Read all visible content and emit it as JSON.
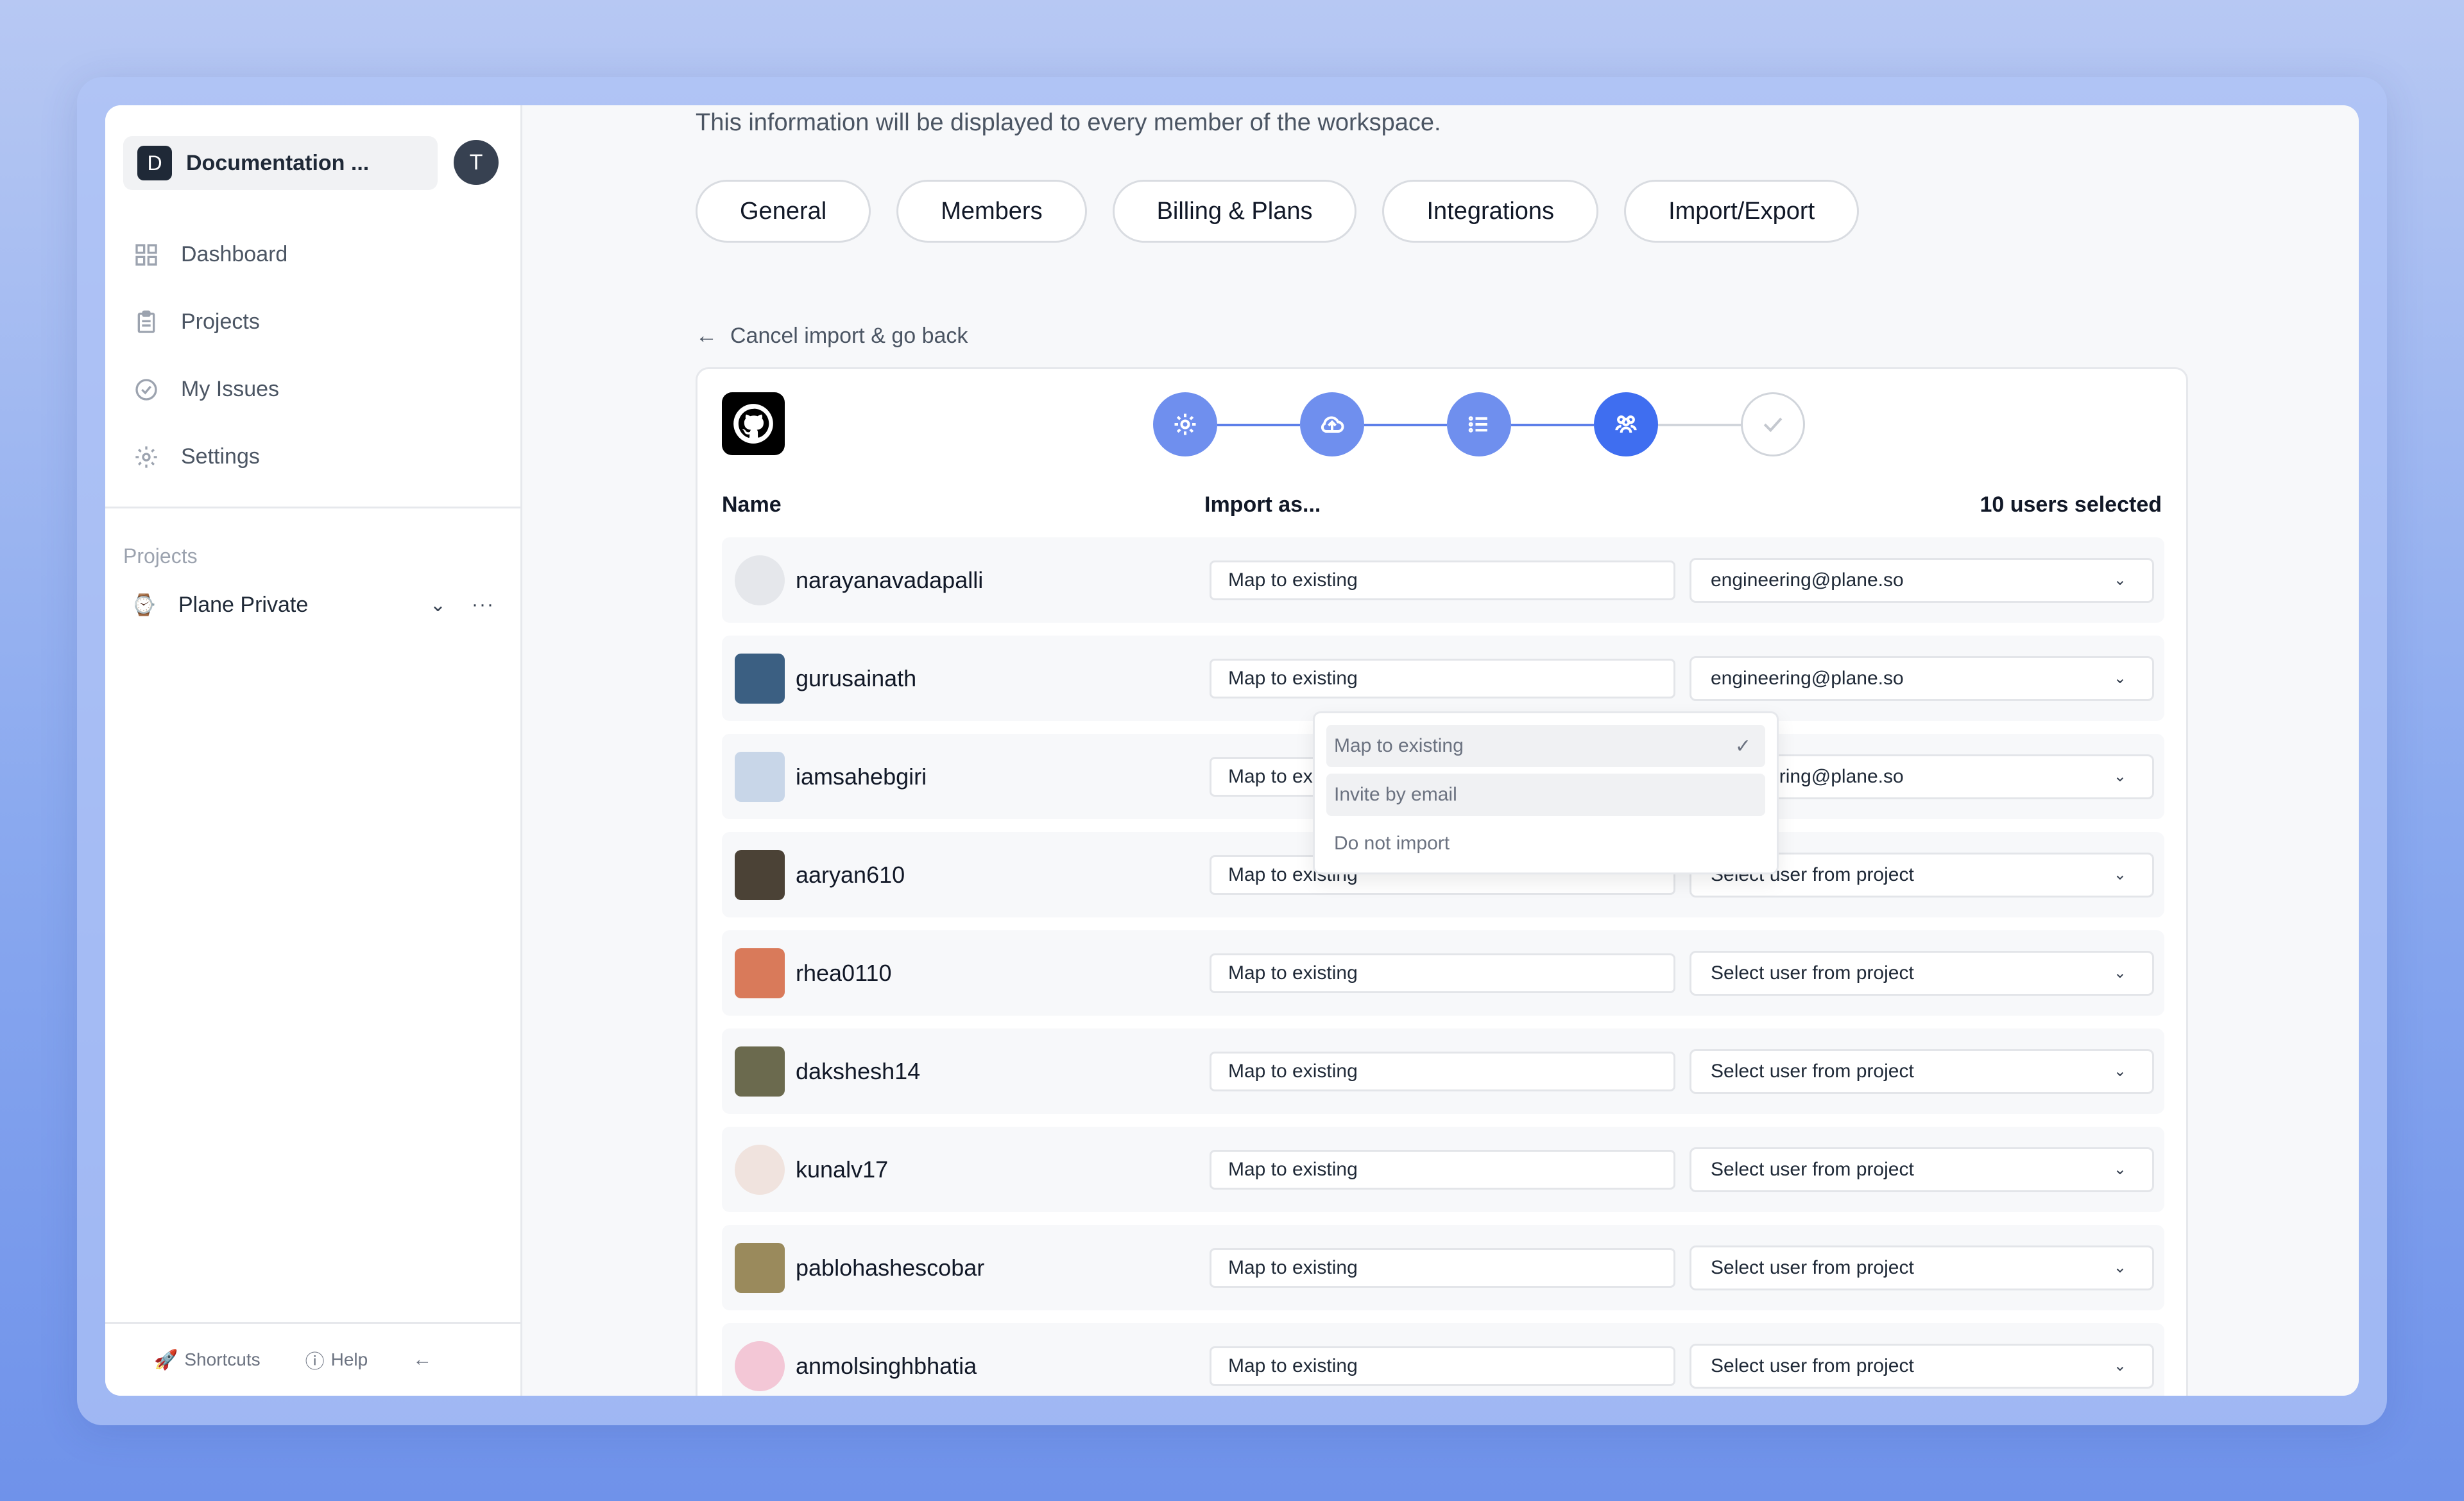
{
  "sidebar": {
    "workspace_badge": "D",
    "workspace_name": "Documentation ...",
    "user_avatar": "T",
    "nav": [
      {
        "label": "Dashboard",
        "icon": "grid-icon"
      },
      {
        "label": "Projects",
        "icon": "clipboard-icon"
      },
      {
        "label": "My Issues",
        "icon": "check-circle-icon"
      },
      {
        "label": "Settings",
        "icon": "gear-icon"
      }
    ],
    "projects_heading": "Projects",
    "project": {
      "name": "Plane Private",
      "icon": "watch-icon"
    },
    "footer": {
      "shortcuts": "Shortcuts",
      "help": "Help"
    }
  },
  "main": {
    "info_text": "This information will be displayed to every member of the workspace.",
    "tabs": [
      "General",
      "Members",
      "Billing & Plans",
      "Integrations",
      "Import/Export"
    ],
    "back_link": "Cancel import & go back",
    "columns": {
      "name": "Name",
      "import_as": "Import as...",
      "selected": "10 users selected"
    },
    "rows": [
      {
        "name": "narayanavadapalli",
        "import_as": "Map to existing",
        "target": "engineering@plane.so",
        "avatar_color": "#e5e7eb"
      },
      {
        "name": "gurusainath",
        "import_as": "Map to existing",
        "target": "engineering@plane.so",
        "avatar_color": "#3b5f82"
      },
      {
        "name": "iamsahebgiri",
        "import_as": "Map to existing",
        "target": "engineering@plane.so",
        "avatar_color": "#c8d6e8"
      },
      {
        "name": "aaryan610",
        "import_as": "Map to existing",
        "target": "Select user from project",
        "avatar_color": "#4b4236"
      },
      {
        "name": "rhea0110",
        "import_as": "Map to existing",
        "target": "Select user from project",
        "avatar_color": "#d97a5a"
      },
      {
        "name": "dakshesh14",
        "import_as": "Map to existing",
        "target": "Select user from project",
        "avatar_color": "#6b6a4e"
      },
      {
        "name": "kunalv17",
        "import_as": "Map to existing",
        "target": "Select user from project",
        "avatar_color": "#f0e3de"
      },
      {
        "name": "pablohashescobar",
        "import_as": "Map to existing",
        "target": "Select user from project",
        "avatar_color": "#9a8a5c"
      },
      {
        "name": "anmolsinghbhatia",
        "import_as": "Map to existing",
        "target": "Select user from project",
        "avatar_color": "#f3c7d6"
      }
    ],
    "dropdown": {
      "options": [
        "Map to existing",
        "Invite by email",
        "Do not import"
      ],
      "selected": "Map to existing"
    }
  },
  "colors": {
    "accent": "#3f6ef0",
    "step_done": "#6f8fee",
    "background": "#f7f8fa"
  }
}
